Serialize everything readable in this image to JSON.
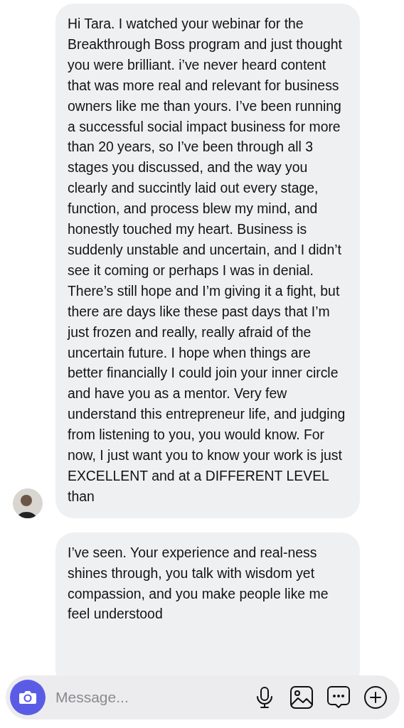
{
  "messages": [
    {
      "text": "Hi Tara. I watched your webinar for the Breakthrough Boss program and just thought you were brilliant. i’ve never heard content that was more real and relevant for business owners like me than yours. I’ve been running a successful social impact business for more than 20 years, so I’ve been through all 3 stages you discussed, and the way you clearly and succintly laid out every stage, function, and process blew my mind, and honestly touched my heart. Business is suddenly unstable and uncertain, and I didn’t see it coming or perhaps I was in denial. There’s still hope and I’m giving it a fight, but there are days like these past days that I’m just frozen and really, really afraid of the uncertain future. I hope when things are better financially I could join your inner circle and have you as a mentor. Very few understand this entrepreneur life, and judging from listening to you, you would know. For now, I just want you to know your work is just EXCELLENT and at a DIFFERENT LEVEL than",
      "avatar": true
    },
    {
      "text": "I’ve seen. Your experience and real-ness shines through, you talk with wisdom yet compassion, and you make people like me feel understood",
      "avatar": false
    }
  ],
  "composer": {
    "placeholder": "Message..."
  }
}
